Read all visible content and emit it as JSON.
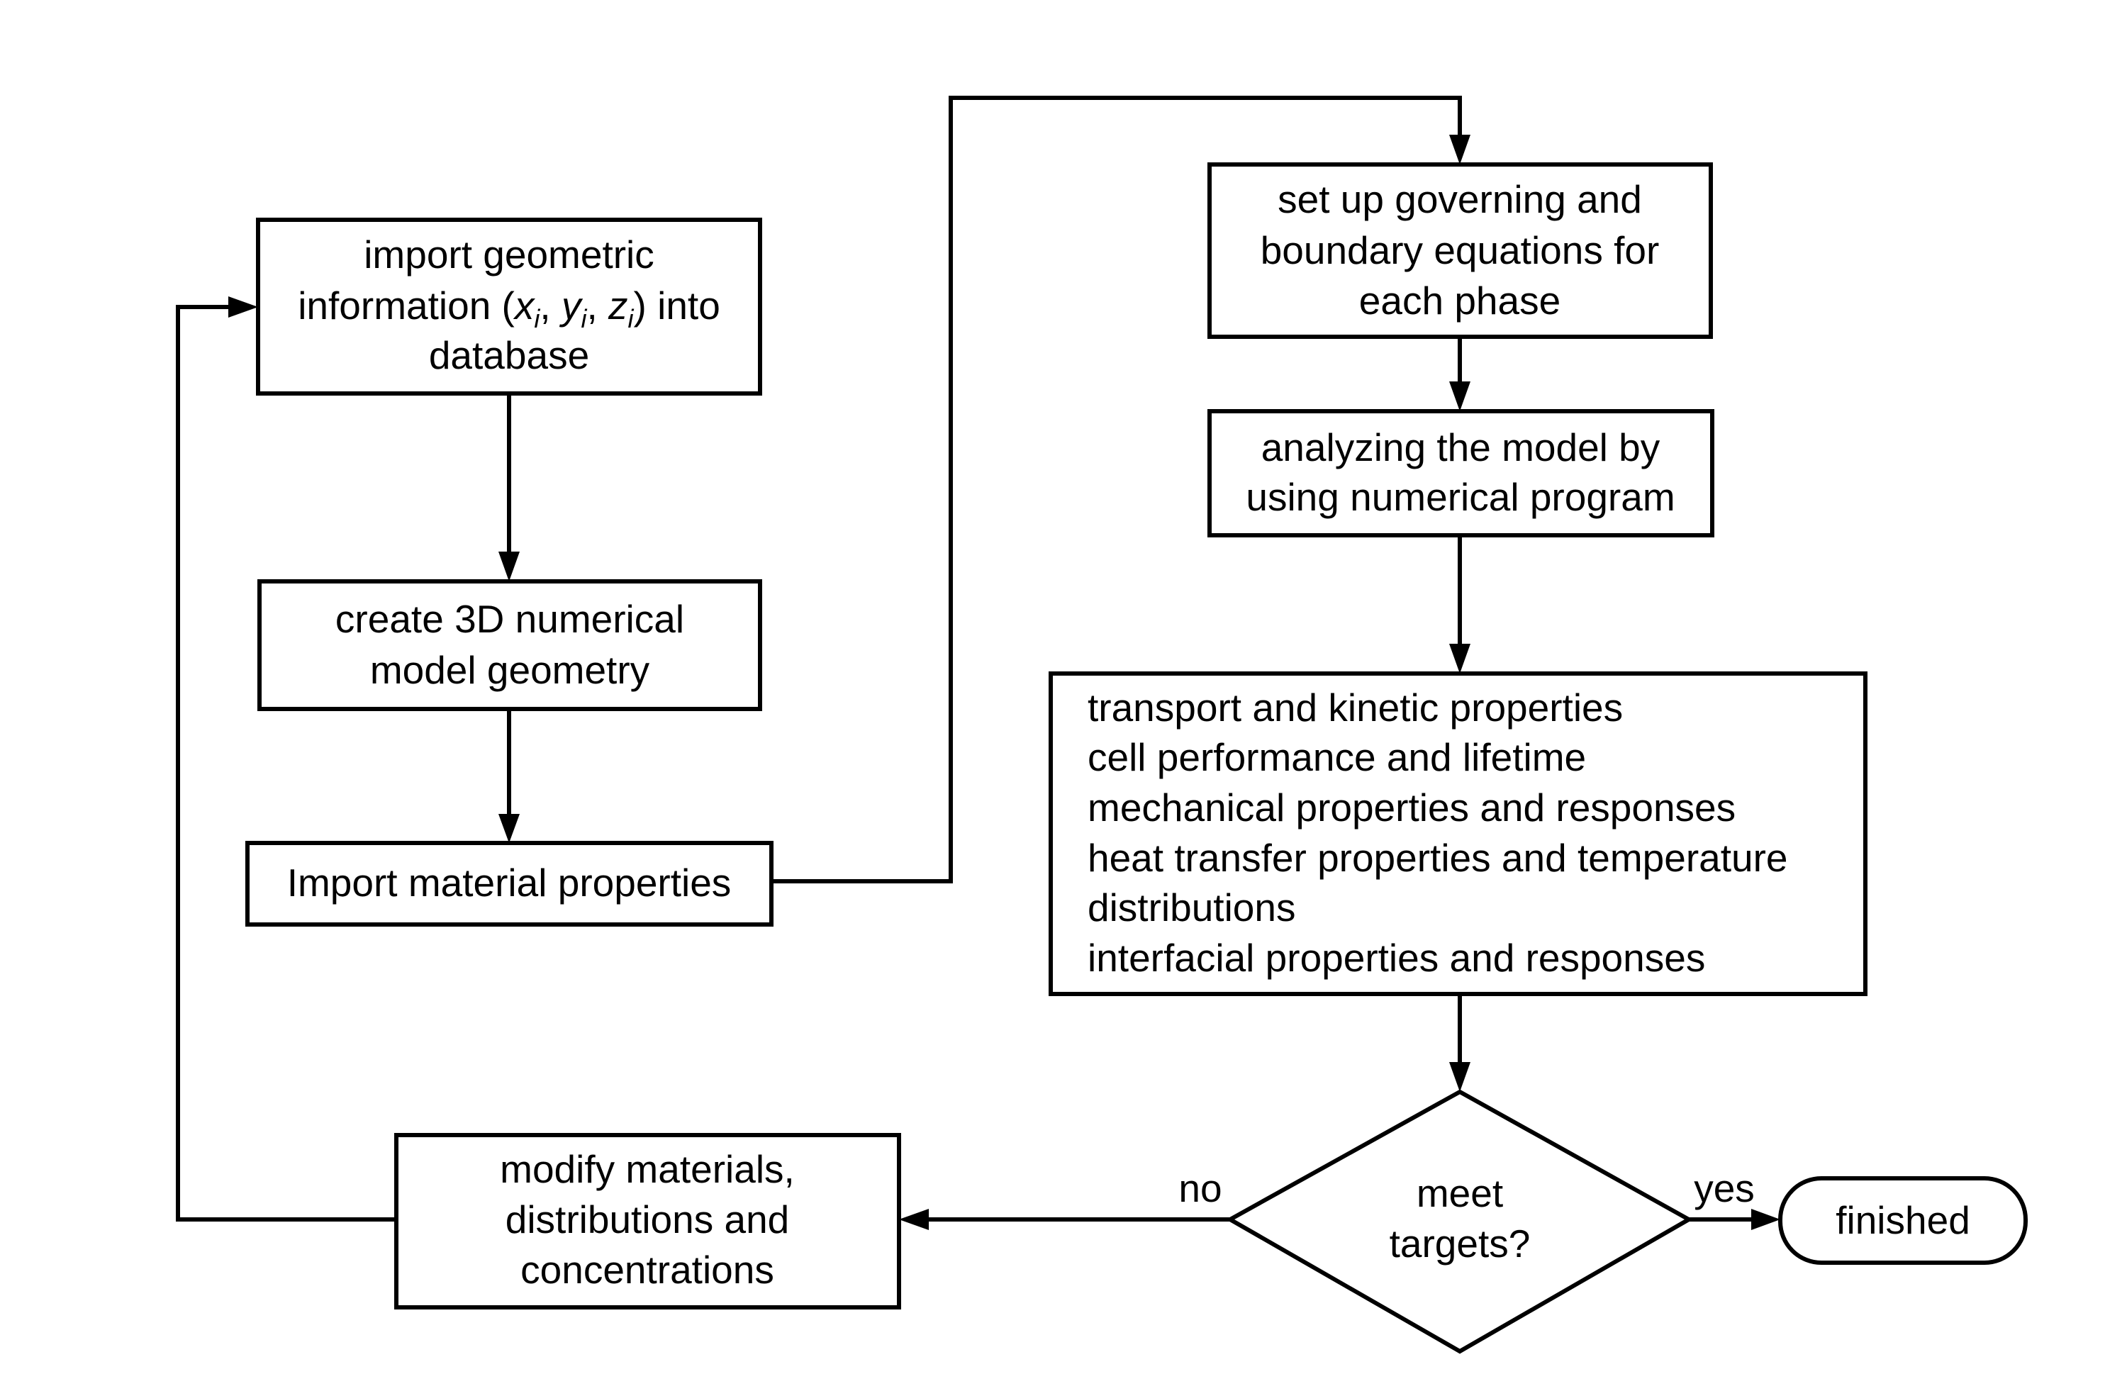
{
  "diagram": {
    "type": "flowchart",
    "colors": {
      "stroke": "#000000",
      "background": "#ffffff",
      "text": "#000000"
    },
    "nodes": {
      "import_geometry": {
        "lines": [
          "import geometric",
          "into",
          "database"
        ],
        "math": {
          "prefix": "information (",
          "x": "x",
          "y": "y",
          "z": "z",
          "sub": "i",
          "sep": ", ",
          "suffix": ")"
        }
      },
      "create_model": {
        "lines": [
          "create 3D numerical",
          "model geometry"
        ]
      },
      "import_material": {
        "lines": [
          "Import material properties"
        ]
      },
      "governing_equations": {
        "lines": [
          "set up governing and",
          "boundary equations for",
          "each phase"
        ]
      },
      "analyze": {
        "lines": [
          "analyzing the model by",
          "using numerical program"
        ]
      },
      "properties": {
        "lines": [
          "transport and kinetic properties",
          "cell performance and lifetime",
          "mechanical properties and responses",
          "heat transfer properties and temperature",
          "distributions",
          "interfacial properties and responses"
        ]
      },
      "decision": {
        "lines": [
          "meet",
          "targets?"
        ]
      },
      "finished": {
        "lines": [
          "finished"
        ]
      },
      "modify": {
        "lines": [
          "modify materials,",
          "distributions and",
          "concentrations"
        ]
      }
    },
    "edge_labels": {
      "no": "no",
      "yes": "yes"
    },
    "edges": [
      {
        "from": "import_geometry",
        "to": "create_model"
      },
      {
        "from": "create_model",
        "to": "import_material"
      },
      {
        "from": "import_material",
        "to": "governing_equations"
      },
      {
        "from": "governing_equations",
        "to": "analyze"
      },
      {
        "from": "analyze",
        "to": "properties"
      },
      {
        "from": "properties",
        "to": "decision"
      },
      {
        "from": "decision",
        "to": "finished",
        "label": "yes"
      },
      {
        "from": "decision",
        "to": "modify",
        "label": "no"
      },
      {
        "from": "modify",
        "to": "import_geometry"
      }
    ]
  }
}
